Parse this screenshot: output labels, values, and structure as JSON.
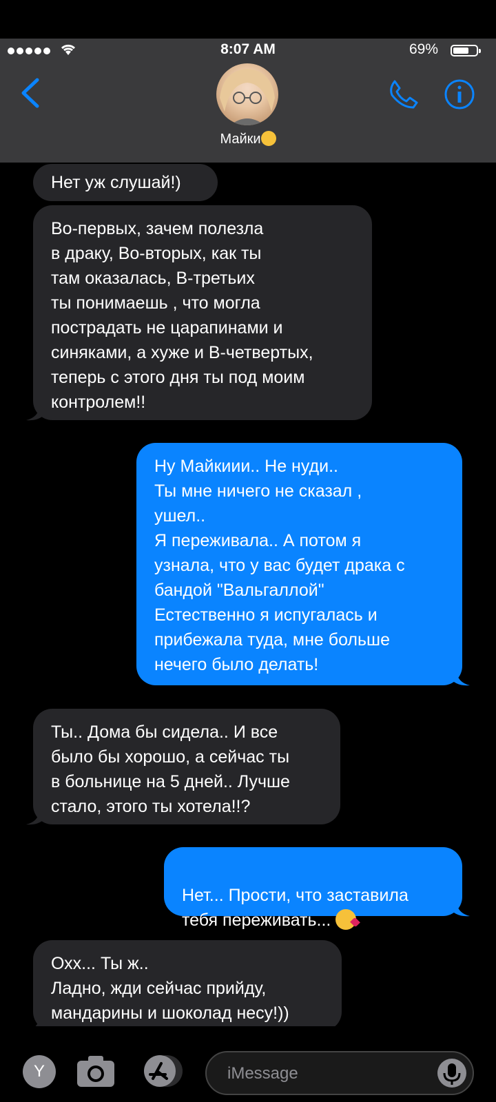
{
  "status": {
    "time": "8:07 AM",
    "battery": "69%"
  },
  "contact": {
    "name": "Майки"
  },
  "messages": [
    {
      "dir": "in",
      "text": "Нет уж слушай!)"
    },
    {
      "dir": "in",
      "text": "Во-первых, зачем полезла\nв драку, Во-вторых, как ты\nтам оказалась, В-третьих\nты понимаешь , что могла\nпострадать не царапинами и\nсиняками, а хуже и В-четвертых,\nтеперь с этого дня ты под  моим\nконтролем!!"
    },
    {
      "dir": "out",
      "text": "Ну Майкиии.. Не нуди..\nТы мне ничего не сказал ,\nушел..\nЯ переживала.. А потом я\nузнала, что у вас  будет драка с\nбандой \"Вальгаллой\"\nЕстественно я испугалась и\nприбежала туда, мне больше\nнечего было делать!"
    },
    {
      "dir": "in",
      "text": "Ты.. Дома бы сидела.. И все\nбыло бы хорошо, а сейчас ты\nв больнице на 5 дней.. Лучше\nстало, этого ты хотела!!?"
    },
    {
      "dir": "out",
      "text": "Нет... Прости, что заставила\nтебя переживать..."
    },
    {
      "dir": "in",
      "text": "Охх... Ты ж..\nЛадно, жди сейчас прийду,\nмандарины и шоколад несу!))"
    }
  ],
  "composer": {
    "placeholder": "iMessage",
    "app_letter": "Y"
  },
  "colors": {
    "outgoing": "#0a84ff",
    "incoming": "#262629",
    "accent": "#0a84ff"
  }
}
